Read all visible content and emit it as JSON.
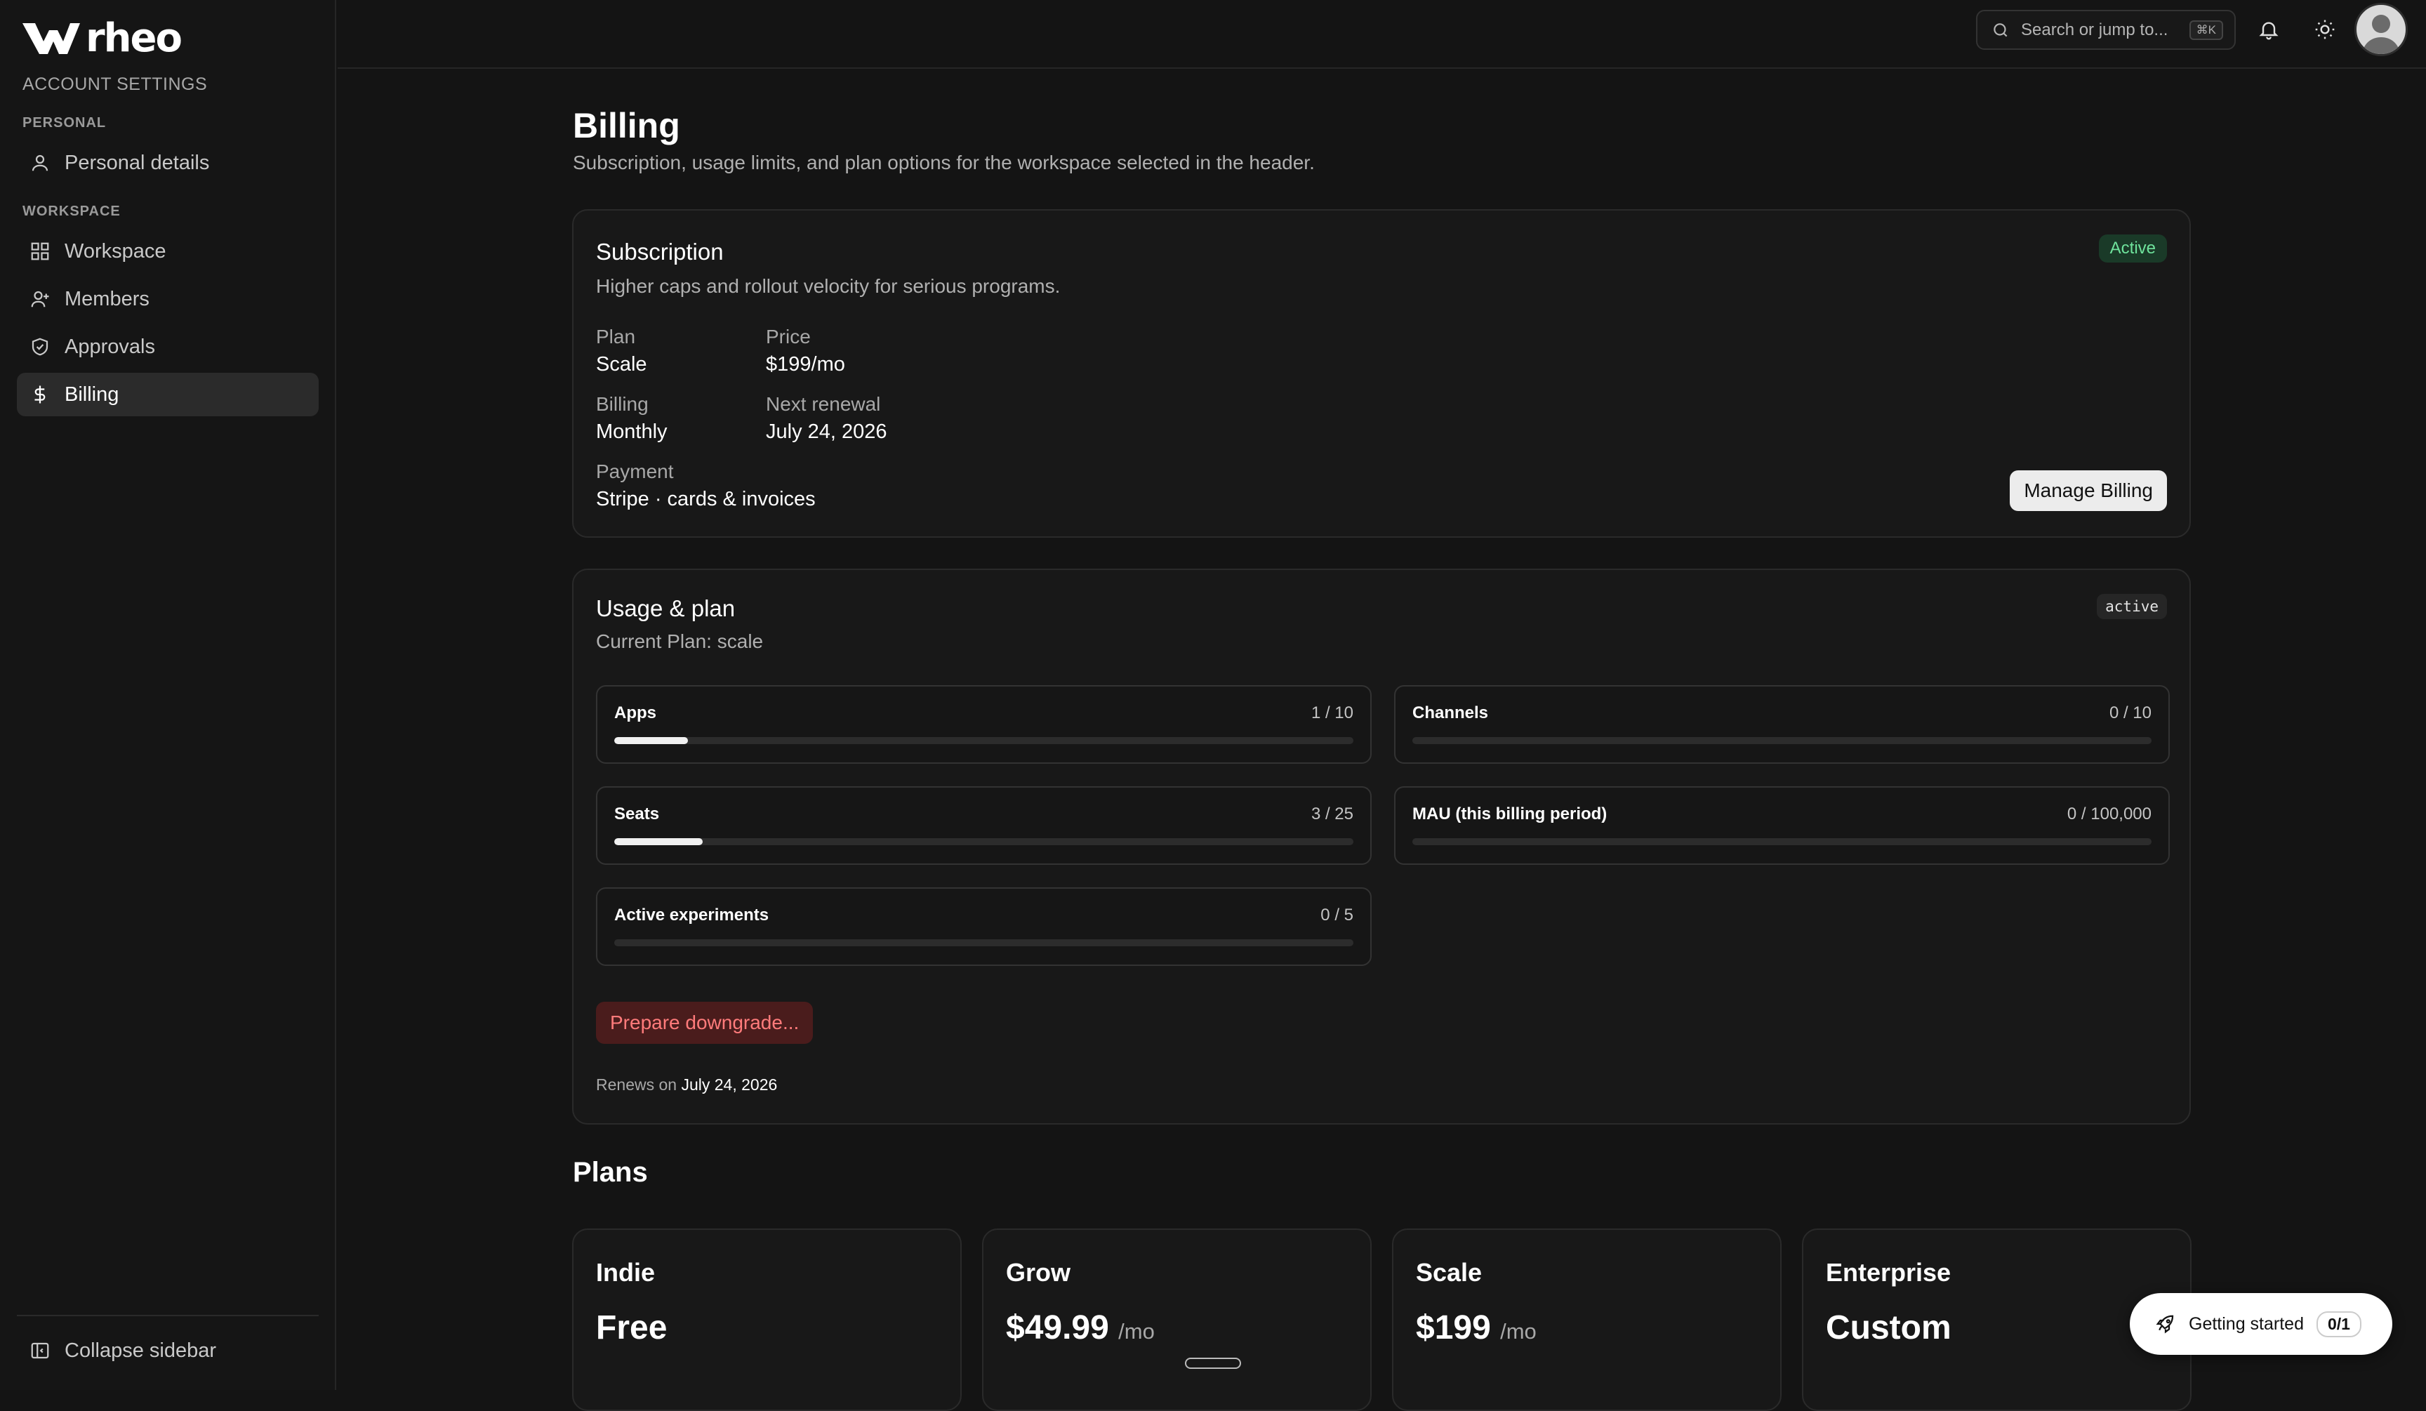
{
  "brand": {
    "name": "rheo"
  },
  "sidebar": {
    "heading": "ACCOUNT SETTINGS",
    "personal_section": "PERSONAL",
    "personal_items": [
      {
        "label": "Personal details",
        "icon": "user-icon"
      }
    ],
    "workspace_section": "WORKSPACE",
    "workspace_items": [
      {
        "label": "Workspace",
        "icon": "grid-icon"
      },
      {
        "label": "Members",
        "icon": "user-add-icon"
      },
      {
        "label": "Approvals",
        "icon": "shield-check-icon"
      },
      {
        "label": "Billing",
        "icon": "dollar-icon",
        "active": true
      }
    ],
    "collapse_label": "Collapse sidebar"
  },
  "topbar": {
    "search_placeholder": "Search or jump to...",
    "search_shortcut": "⌘K"
  },
  "page": {
    "title": "Billing",
    "subtitle": "Subscription, usage limits, and plan options for the workspace selected in the header."
  },
  "subscription": {
    "title": "Subscription",
    "status": "Active",
    "description": "Higher caps and rollout velocity for serious programs.",
    "plan_label": "Plan",
    "plan_value": "Scale",
    "price_label": "Price",
    "price_value": "$199/mo",
    "billing_label": "Billing",
    "billing_value": "Monthly",
    "renewal_label": "Next renewal",
    "renewal_value": "July 24, 2026",
    "payment_label": "Payment",
    "payment_value": "Stripe · cards & invoices",
    "manage_button": "Manage Billing"
  },
  "usage": {
    "title": "Usage & plan",
    "status": "active",
    "current_plan": "Current Plan: scale",
    "meters": [
      {
        "label": "Apps",
        "count": "1 / 10",
        "used": 1,
        "limit": 10
      },
      {
        "label": "Channels",
        "count": "0 / 10",
        "used": 0,
        "limit": 10
      },
      {
        "label": "Seats",
        "count": "3 / 25",
        "used": 3,
        "limit": 25
      },
      {
        "label": "MAU (this billing period)",
        "count": "0 / 100,000",
        "used": 0,
        "limit": 100000
      },
      {
        "label": "Active experiments",
        "count": "0 / 5",
        "used": 0,
        "limit": 5
      }
    ],
    "downgrade_button": "Prepare downgrade...",
    "renews_prefix": "Renews on",
    "renews_date": "July 24, 2026"
  },
  "plans": {
    "title": "Plans",
    "items": [
      {
        "name": "Indie",
        "price": "Free",
        "period": ""
      },
      {
        "name": "Grow",
        "price": "$49.99",
        "period": "/mo"
      },
      {
        "name": "Scale",
        "price": "$199",
        "period": "/mo"
      },
      {
        "name": "Enterprise",
        "price": "Custom",
        "period": ""
      }
    ]
  },
  "getting_started": {
    "label": "Getting started",
    "count": "0/1"
  }
}
